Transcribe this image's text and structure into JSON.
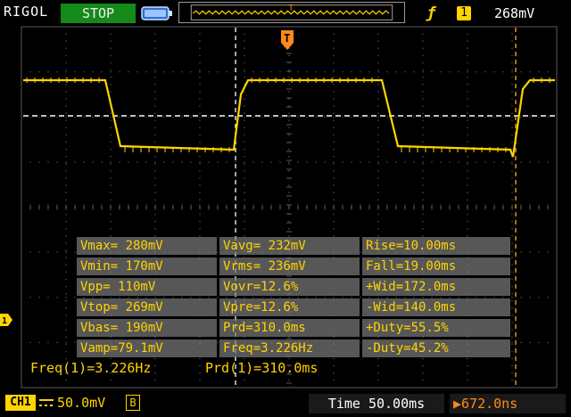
{
  "header": {
    "brand": "RIGOL",
    "run_state": "STOP",
    "trigger_marker": "T",
    "trigger_source": "1",
    "trigger_level": "268mV",
    "icons": [
      "battery-icon",
      "rising-edge-icon"
    ]
  },
  "waveform": {
    "channel": "CH1",
    "trigger_marker": "T",
    "channel_marker": "1",
    "color": "#ffd400"
  },
  "measurements": {
    "rows": [
      [
        "Vmax= 280mV",
        "Vavg= 232mV",
        "Rise=10.00ms"
      ],
      [
        "Vmin= 170mV",
        "Vrms= 236mV",
        "Fall=19.00ms"
      ],
      [
        "Vpp= 110mV",
        "Vovr=12.6%",
        "+Wid=172.0ms"
      ],
      [
        "Vtop= 269mV",
        "Vpre=12.6%",
        "-Wid=140.0ms"
      ],
      [
        "Vbas= 190mV",
        "Prd=310.0ms",
        "+Duty=55.5%"
      ],
      [
        "Vamp=79.1mV",
        "Freq=3.226Hz",
        "-Duty=45.2%"
      ]
    ]
  },
  "counters": {
    "freq": "Freq(1)=3.226Hz",
    "period": "Prd(1)=310.0ms"
  },
  "footer": {
    "ch1_label": "CH1",
    "ch1_scale": "50.0mV",
    "bandwidth_badge": "B",
    "timebase": "Time 50.00ms",
    "trigger_offset": "672.0ns",
    "trigger_offset_icon": "trigger-offset-icon"
  },
  "colors": {
    "channel1": "#ffd400",
    "stop_bg": "#138a1a",
    "trigger": "#ff8a1a",
    "panel": "#787878"
  }
}
